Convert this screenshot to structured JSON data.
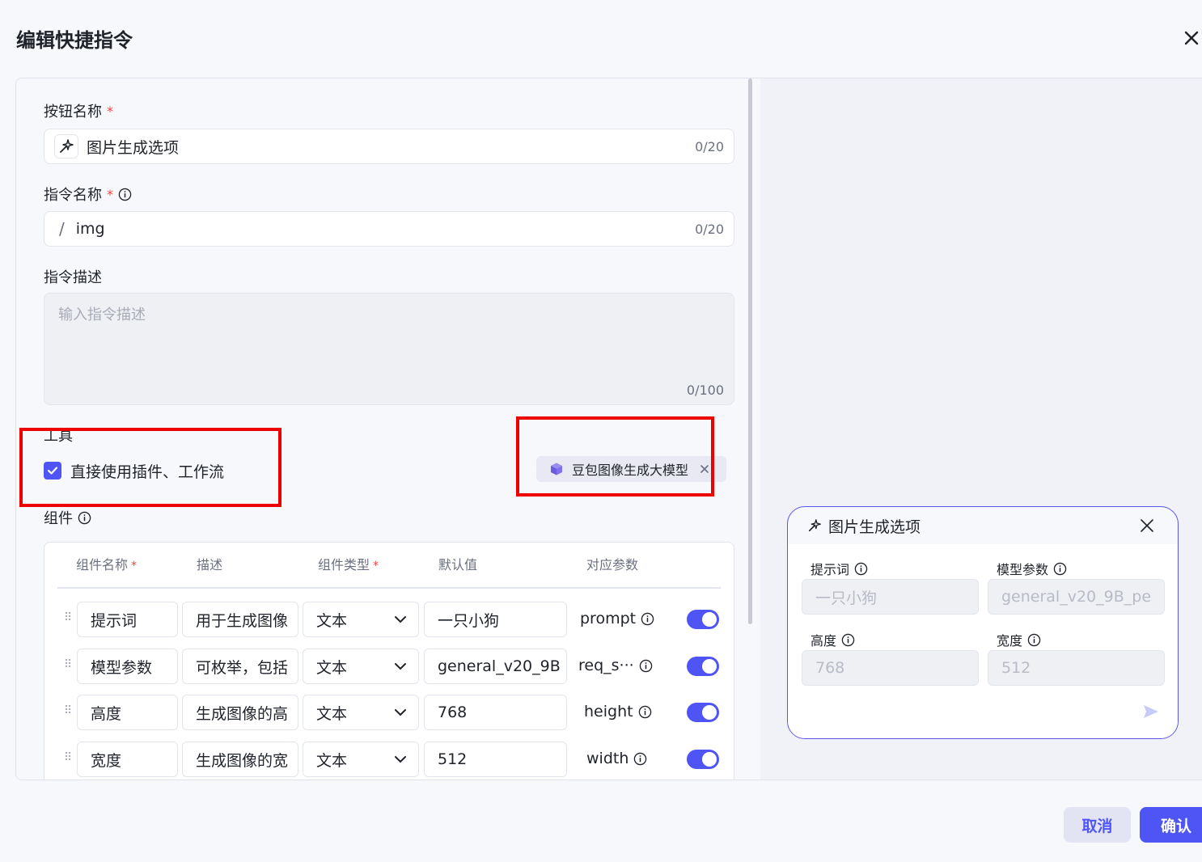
{
  "dialog": {
    "title": "编辑快捷指令",
    "close_icon": "close-icon"
  },
  "form": {
    "button_name": {
      "label": "按钮名称",
      "required": "*",
      "icon": "sparkle-icon",
      "value": "图片生成选项",
      "count": "0/20"
    },
    "command_name": {
      "label": "指令名称",
      "required": "*",
      "prefix": "/",
      "value": "img",
      "count": "0/20"
    },
    "command_desc": {
      "label": "指令描述",
      "placeholder": "输入指令描述",
      "count": "0/100"
    },
    "tools": {
      "label": "工具",
      "checkbox_label": "直接使用插件、工作流",
      "checked": true,
      "chip_label": "豆包图像生成大模型",
      "chip_icon": "cube-icon"
    },
    "components": {
      "label": "组件",
      "headers": {
        "name": "组件名称",
        "name_required": "*",
        "desc": "描述",
        "type": "组件类型",
        "type_required": "*",
        "default": "默认值",
        "param": "对应参数"
      },
      "rows": [
        {
          "name": "提示词",
          "desc": "用于生成图像",
          "type": "文本",
          "default": "一只小狗",
          "param": "prompt",
          "enabled": true
        },
        {
          "name": "模型参数",
          "desc": "可枚举，包括",
          "type": "文本",
          "default": "general_v20_9B",
          "param": "req_s···",
          "enabled": true
        },
        {
          "name": "高度",
          "desc": "生成图像的高",
          "type": "文本",
          "default": "768",
          "param": "height",
          "enabled": true
        },
        {
          "name": "宽度",
          "desc": "生成图像的宽",
          "type": "文本",
          "default": "512",
          "param": "width",
          "enabled": true
        }
      ]
    }
  },
  "preview": {
    "title": "图片生成选项",
    "fields": [
      {
        "label": "提示词",
        "value": "一只小狗"
      },
      {
        "label": "模型参数",
        "value": "general_v20_9B_pe"
      },
      {
        "label": "高度",
        "value": "768"
      },
      {
        "label": "宽度",
        "value": "512"
      }
    ],
    "send_icon": "send-icon"
  },
  "footer": {
    "cancel_label": "取消",
    "confirm_label": "确认"
  },
  "colors": {
    "accent": "#4f55f5",
    "required": "#f53f3f",
    "highlight_box": "#ee0000"
  }
}
